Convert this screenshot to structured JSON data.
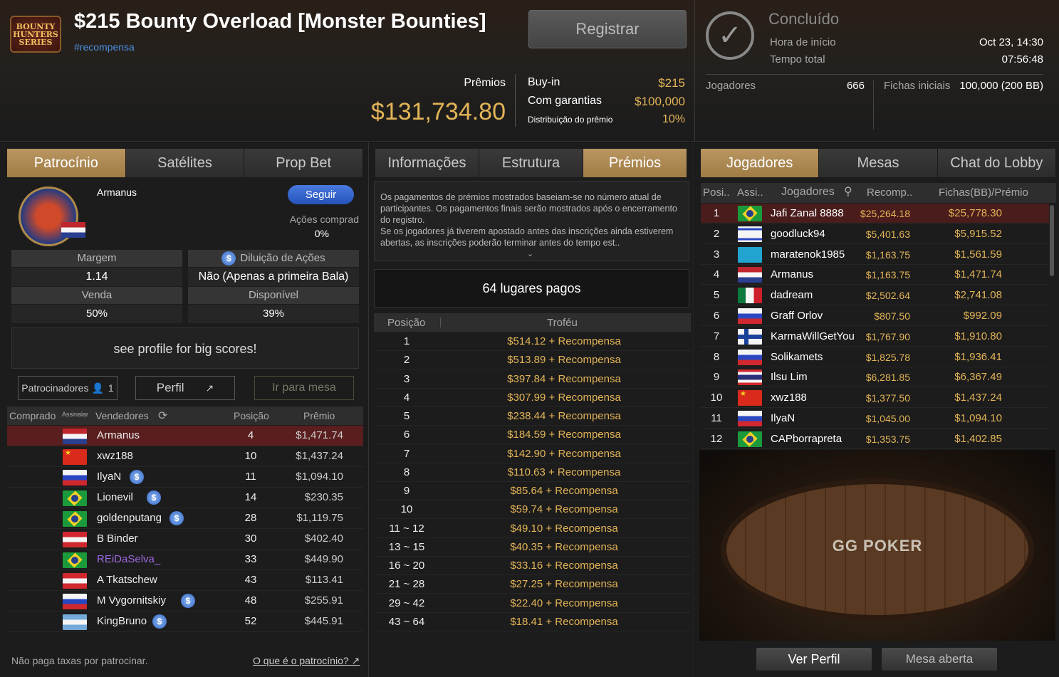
{
  "header": {
    "logo_text": "BOUNTY HUNTERS SERIES",
    "title": "$215 Bounty Overload [Monster Bounties]",
    "hashtag": "#recompensa",
    "register_label": "Registrar",
    "prizes_label": "Prêmios",
    "prize_total": "$131,734.80",
    "buyin_label": "Buy-in",
    "buyin_value": "$215",
    "guarantee_label": "Com garantias",
    "guarantee_value": "$100,000",
    "distribution_label": "Distribuição do prêmio",
    "distribution_value": "10%",
    "status": "Concluído",
    "start_label": "Hora de início",
    "start_value": "Oct 23, 14:30",
    "elapsed_label": "Tempo total",
    "elapsed_value": "07:56:48",
    "players_label": "Jogadores",
    "players_value": "666",
    "chips_label": "Fichas iniciais",
    "chips_value": "100,000 (200 BB)"
  },
  "left": {
    "tabs": [
      "Patrocínio",
      "Satélites",
      "Prop Bet"
    ],
    "player_name": "Armanus",
    "follow_label": "Seguir",
    "shares_label": "Ações comprad",
    "shares_value": "0%",
    "margin_label": "Margem",
    "margin_value": "1.14",
    "dilution_label": "Diluição de Ações",
    "dilution_value": "Não (Apenas a primeira Bala)",
    "sale_label": "Venda",
    "sale_value": "50%",
    "available_label": "Disponível",
    "available_value": "39%",
    "message": "see profile for big scores!",
    "sponsors_label": "Patrocinadores",
    "sponsors_count": "1",
    "profile_label": "Perfil",
    "goto_table_label": "Ir para mesa",
    "col_bought": "Comprado",
    "col_sign": "Assinalar",
    "col_sellers": "Vendedores",
    "col_position": "Posição",
    "col_prize": "Prêmio",
    "rows": [
      {
        "flag": "f-nl",
        "name": "Armanus",
        "coin": false,
        "pos": "4",
        "prize": "$1,471.74"
      },
      {
        "flag": "f-cn",
        "name": "xwz188",
        "coin": false,
        "pos": "10",
        "prize": "$1,437.24"
      },
      {
        "flag": "f-ru",
        "name": "IlyaN",
        "coin": true,
        "pos": "11",
        "prize": "$1,094.10"
      },
      {
        "flag": "f-br",
        "name": "Lionevil",
        "coin": true,
        "pos": "14",
        "prize": "$230.35"
      },
      {
        "flag": "f-br",
        "name": "goldenputang",
        "coin": true,
        "pos": "28",
        "prize": "$1,119.75"
      },
      {
        "flag": "f-at",
        "name": "B Binder",
        "coin": false,
        "pos": "30",
        "prize": "$402.40"
      },
      {
        "flag": "f-br",
        "name": "REiDaSelva_",
        "coin": false,
        "pos": "33",
        "prize": "$449.90"
      },
      {
        "flag": "f-at",
        "name": "A Tkatschew",
        "coin": false,
        "pos": "43",
        "prize": "$113.41"
      },
      {
        "flag": "f-ru",
        "name": "M Vygornitskiy",
        "coin": true,
        "pos": "48",
        "prize": "$255.91"
      },
      {
        "flag": "f-ar",
        "name": "KingBruno",
        "coin": true,
        "pos": "52",
        "prize": "$445.91"
      }
    ],
    "footer_note": "Não paga taxas por patrocinar.",
    "footer_link": "O que é o patrocínio?"
  },
  "mid": {
    "tabs": [
      "Informações",
      "Estrutura",
      "Prémios"
    ],
    "info_text": "Os pagamentos de prémios mostrados baseiam-se no número atual de participantes. Os pagamentos finais serão mostrados após o encerramento do registro.\nSe os jogadores já tiverem apostado antes das inscrições ainda estiverem abertas, as inscrições poderão terminar antes do tempo est..",
    "places_paid": "64 lugares pagos",
    "col_position": "Posição",
    "col_trophy": "Troféu",
    "rows": [
      [
        "1",
        "$514.12 + Recompensa"
      ],
      [
        "2",
        "$513.89 + Recompensa"
      ],
      [
        "3",
        "$397.84 + Recompensa"
      ],
      [
        "4",
        "$307.99 + Recompensa"
      ],
      [
        "5",
        "$238.44 + Recompensa"
      ],
      [
        "6",
        "$184.59 + Recompensa"
      ],
      [
        "7",
        "$142.90 + Recompensa"
      ],
      [
        "8",
        "$110.63 + Recompensa"
      ],
      [
        "9",
        "$85.64 + Recompensa"
      ],
      [
        "10",
        "$59.74 + Recompensa"
      ],
      [
        "11 ~ 12",
        "$49.10 + Recompensa"
      ],
      [
        "13 ~ 15",
        "$40.35 + Recompensa"
      ],
      [
        "16 ~ 20",
        "$33.16 + Recompensa"
      ],
      [
        "21 ~ 28",
        "$27.25 + Recompensa"
      ],
      [
        "29 ~ 42",
        "$22.40 + Recompensa"
      ],
      [
        "43 ~ 64",
        "$18.41 + Recompensa"
      ]
    ]
  },
  "right": {
    "tabs": [
      "Jogadores",
      "Mesas",
      "Chat do Lobby"
    ],
    "col_pos": "Posi..",
    "col_sign": "Assi..",
    "col_players": "Jogadores",
    "col_bounty": "Recomp..",
    "col_chips": "Fichas(BB)/Prémio",
    "rows": [
      {
        "pos": "1",
        "flag": "f-br",
        "name": "Jafi Zanal 8888",
        "bounty": "$25,264.18",
        "prize": "$25,778.30"
      },
      {
        "pos": "2",
        "flag": "f-il",
        "name": "goodluck94",
        "bounty": "$5,401.63",
        "prize": "$5,915.52"
      },
      {
        "pos": "3",
        "flag": "f-kz",
        "name": "maratenok1985",
        "bounty": "$1,163.75",
        "prize": "$1,561.59"
      },
      {
        "pos": "4",
        "flag": "f-nl",
        "name": "Armanus",
        "bounty": "$1,163.75",
        "prize": "$1,471.74"
      },
      {
        "pos": "5",
        "flag": "f-mx",
        "name": "dadream",
        "bounty": "$2,502.64",
        "prize": "$2,741.08"
      },
      {
        "pos": "6",
        "flag": "f-ru",
        "name": "Graff Orlov",
        "bounty": "$807.50",
        "prize": "$992.09"
      },
      {
        "pos": "7",
        "flag": "f-fi",
        "name": "KarmaWillGetYou",
        "bounty": "$1,767.90",
        "prize": "$1,910.80"
      },
      {
        "pos": "8",
        "flag": "f-ru",
        "name": "Solikamets",
        "bounty": "$1,825.78",
        "prize": "$1,936.41"
      },
      {
        "pos": "9",
        "flag": "f-th",
        "name": "Ilsu Lim",
        "bounty": "$6,281.85",
        "prize": "$6,367.49"
      },
      {
        "pos": "10",
        "flag": "f-cn",
        "name": "xwz188",
        "bounty": "$1,377.50",
        "prize": "$1,437.24"
      },
      {
        "pos": "11",
        "flag": "f-ru",
        "name": "IlyaN",
        "bounty": "$1,045.00",
        "prize": "$1,094.10"
      },
      {
        "pos": "12",
        "flag": "f-br",
        "name": "CAPborrapreta",
        "bounty": "$1,353.75",
        "prize": "$1,402.85"
      }
    ],
    "table_logo": "GG POKER",
    "view_profile_label": "Ver Perfil",
    "open_table_label": "Mesa aberta"
  }
}
